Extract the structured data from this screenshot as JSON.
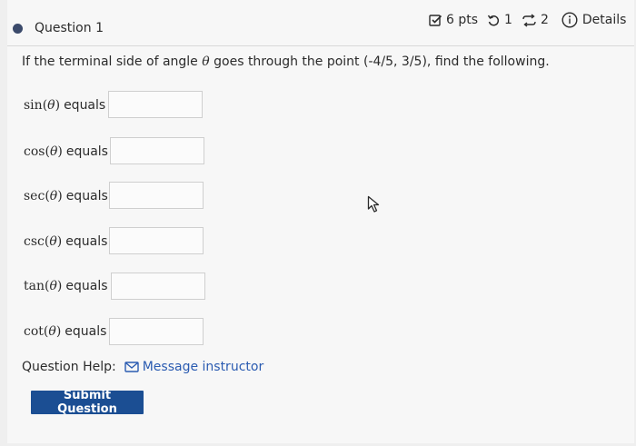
{
  "question": {
    "title": "Question 1",
    "points": "6 pts",
    "attempts": "1",
    "retries": "2",
    "details_label": "Details"
  },
  "prompt": {
    "before": "If the terminal side of angle ",
    "symbol": "θ",
    "after": " goes through the point (-4/5, 3/5), find the following."
  },
  "rows": [
    {
      "func": "sin",
      "arg": "θ",
      "equals": "equals",
      "value": ""
    },
    {
      "func": "cos",
      "arg": "θ",
      "equals": "equals",
      "value": ""
    },
    {
      "func": "sec",
      "arg": "θ",
      "equals": "equals",
      "value": ""
    },
    {
      "func": "csc",
      "arg": "θ",
      "equals": "equals",
      "value": ""
    },
    {
      "func": "tan",
      "arg": "θ",
      "equals": "equals",
      "value": ""
    },
    {
      "func": "cot",
      "arg": "θ",
      "equals": "equals",
      "value": ""
    }
  ],
  "help": {
    "label": "Question Help:",
    "message_link": "Message instructor"
  },
  "submit_label": "Submit Question",
  "colors": {
    "accent": "#1b4e93",
    "link": "#2a5bb1",
    "status_dot": "#3b4a6b"
  }
}
